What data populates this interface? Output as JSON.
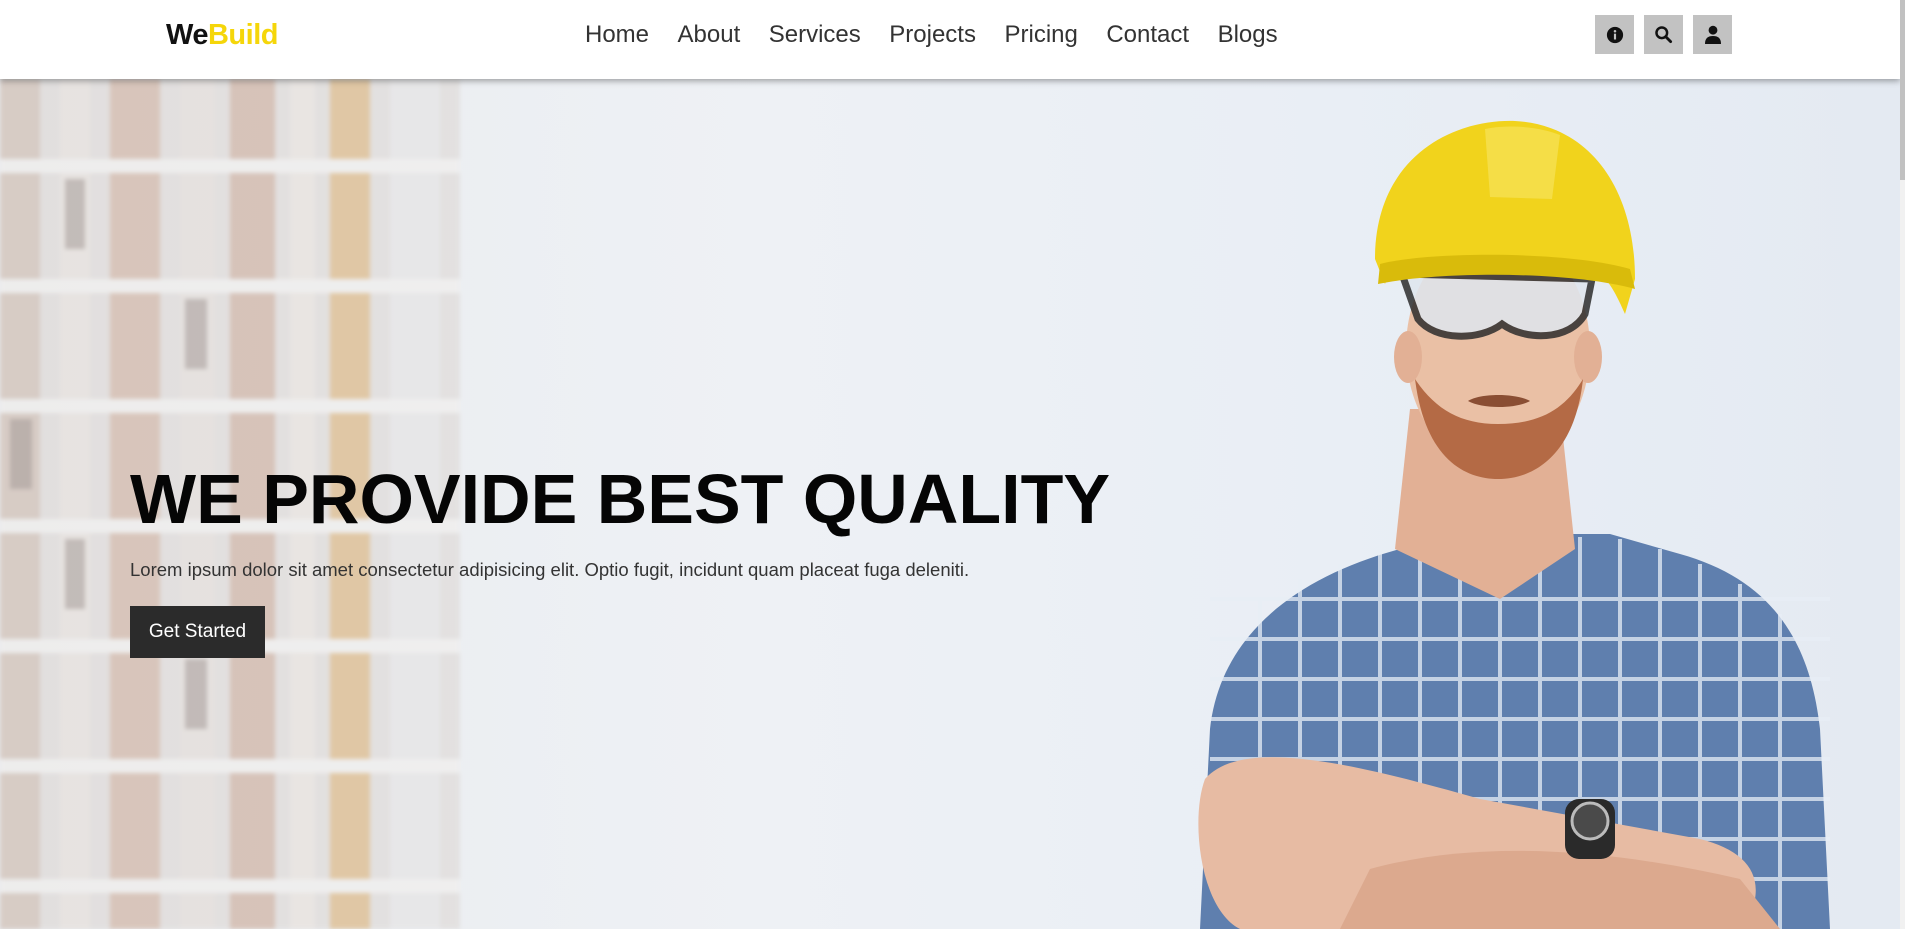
{
  "logo": {
    "part1": "We",
    "part2": "Build"
  },
  "nav": {
    "items": [
      {
        "label": "Home"
      },
      {
        "label": "About"
      },
      {
        "label": "Services"
      },
      {
        "label": "Projects"
      },
      {
        "label": "Pricing"
      },
      {
        "label": "Contact"
      },
      {
        "label": "Blogs"
      }
    ]
  },
  "header_icons": [
    "info-icon",
    "search-icon",
    "user-icon"
  ],
  "hero": {
    "title": "WE PROVIDE BEST QUALITY",
    "text": "Lorem ipsum dolor sit amet consectetur adipisicing elit. Optio fugit, incidunt quam placeat fuga deleniti.",
    "button_label": "Get Started"
  },
  "colors": {
    "accent": "#f5d60a",
    "button_bg": "#2b2b2b",
    "icon_bg": "#c2c2c2"
  }
}
